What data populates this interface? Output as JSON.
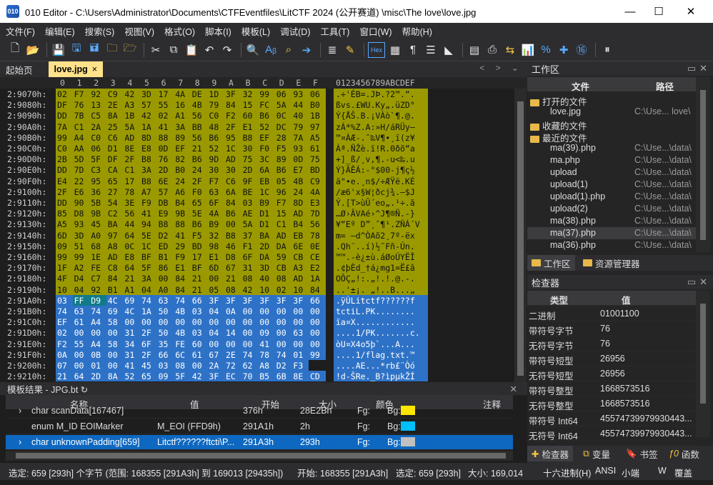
{
  "window": {
    "title": "010 Editor - C:\\Users\\Administrator\\Documents\\CTFEventfiles\\LitCTF 2024 (公开赛道) \\misc\\The love\\love.jpg",
    "icon": "010"
  },
  "menu": [
    "文件(F)",
    "编辑(E)",
    "搜索(S)",
    "视图(V)",
    "格式(O)",
    "脚本(I)",
    "模板(L)",
    "调试(D)",
    "工具(T)",
    "窗口(W)",
    "帮助(H)"
  ],
  "toolbar": {
    "hex_label": "Hex"
  },
  "tabs": [
    {
      "label": "起始页"
    },
    {
      "label": "love.jpg",
      "close": "×"
    }
  ],
  "tab_nav": "< > ⌄",
  "hex": {
    "columns": [
      "0",
      "1",
      "2",
      "3",
      "4",
      "5",
      "6",
      "7",
      "8",
      "9",
      "A",
      "B",
      "C",
      "D",
      "E",
      "F"
    ],
    "ascii_header": "0123456789ABCDEF",
    "rows": [
      {
        "addr": "2:9070h:",
        "bytes": [
          "02",
          "F7",
          "92",
          "C9",
          "42",
          "3D",
          "17",
          "4A",
          "DE",
          "1D",
          "3F",
          "32",
          "99",
          "06",
          "93",
          "06"
        ],
        "ascii": ".÷'ÉB=.JÞ.?2™.“."
      },
      {
        "addr": "2:9080h:",
        "bytes": [
          "DF",
          "76",
          "13",
          "2E",
          "A3",
          "57",
          "55",
          "16",
          "4B",
          "79",
          "84",
          "15",
          "FC",
          "5A",
          "44",
          "B0"
        ],
        "ascii": "ßvs.£WU.Ky„.üZD°"
      },
      {
        "addr": "2:9090h:",
        "bytes": [
          "DD",
          "7B",
          "C5",
          "8A",
          "1B",
          "42",
          "02",
          "A1",
          "56",
          "C0",
          "F2",
          "60",
          "B6",
          "0C",
          "40",
          "1B"
        ],
        "ascii": "Ý{ÅŠ.B.¡VÀò`¶.@."
      },
      {
        "addr": "2:90A0h:",
        "bytes": [
          "7A",
          "C1",
          "2A",
          "25",
          "5A",
          "1A",
          "41",
          "3A",
          "BB",
          "48",
          "2F",
          "E1",
          "52",
          "DC",
          "79",
          "97"
        ],
        "ascii": "zÁ*%Z.A:»H/áRÜy—"
      },
      {
        "addr": "2:90B0h:",
        "bytes": [
          "99",
          "A4",
          "C0",
          "C6",
          "AD",
          "8D",
          "88",
          "89",
          "56",
          "B6",
          "95",
          "B8",
          "EF",
          "28",
          "7A",
          "A5"
        ],
        "ascii": "™¤ÀÆ-.ˆ‰V¶•¸ï(z¥"
      },
      {
        "addr": "2:90C0h:",
        "bytes": [
          "C0",
          "AA",
          "06",
          "D1",
          "8E",
          "E8",
          "0D",
          "EF",
          "21",
          "52",
          "1C",
          "30",
          "F0",
          "F5",
          "93",
          "61"
        ],
        "ascii": "Àª.ÑŽè.ï!R.0ðõ“a"
      },
      {
        "addr": "2:90D0h:",
        "bytes": [
          "2B",
          "5D",
          "5F",
          "DF",
          "2F",
          "B8",
          "76",
          "82",
          "B6",
          "9D",
          "AD",
          "75",
          "3C",
          "89",
          "0D",
          "75"
        ],
        "ascii": "+]_ß/¸v‚¶.-u<‰.u"
      },
      {
        "addr": "2:90E0h:",
        "bytes": [
          "DD",
          "7D",
          "C3",
          "CA",
          "C1",
          "3A",
          "2D",
          "B0",
          "24",
          "30",
          "30",
          "2D",
          "6A",
          "B6",
          "E7",
          "BD"
        ],
        "ascii": "Ý}ÃÊÁ:-°$00-j¶ç½"
      },
      {
        "addr": "2:90F0h:",
        "bytes": [
          "E4",
          "22",
          "95",
          "65",
          "17",
          "B8",
          "6E",
          "24",
          "2F",
          "F7",
          "C6",
          "9F",
          "EB",
          "05",
          "4B",
          "C9"
        ],
        "ascii": "ä\"•e.¸n$/÷ÆŸë.KÉ"
      },
      {
        "addr": "2:9100h:",
        "bytes": [
          "2F",
          "E6",
          "36",
          "27",
          "78",
          "A7",
          "57",
          "A6",
          "F0",
          "63",
          "6A",
          "BE",
          "1C",
          "96",
          "24",
          "4A"
        ],
        "ascii": "/æ6'x§W¦ðcj¾.–$J"
      },
      {
        "addr": "2:9110h:",
        "bytes": [
          "DD",
          "90",
          "5B",
          "54",
          "3E",
          "F9",
          "DB",
          "B4",
          "65",
          "6F",
          "84",
          "03",
          "B9",
          "F7",
          "8D",
          "E3"
        ],
        "ascii": "Ý.[T>ùÛ´eo„.¹÷.ã"
      },
      {
        "addr": "2:9120h:",
        "bytes": [
          "85",
          "D8",
          "9B",
          "C2",
          "56",
          "41",
          "E9",
          "9B",
          "5E",
          "4A",
          "B6",
          "AE",
          "D1",
          "15",
          "AD",
          "7D"
        ],
        "ascii": "…Ø›ÂVAé›^J¶®Ñ.-}"
      },
      {
        "addr": "2:9130h:",
        "bytes": [
          "A5",
          "93",
          "45",
          "BA",
          "44",
          "94",
          "B8",
          "88",
          "B6",
          "B9",
          "00",
          "5A",
          "D1",
          "C1",
          "B4",
          "56"
        ],
        "ascii": "¥“Eº D”¸ˆ¶¹.ZÑÁ´V"
      },
      {
        "addr": "2:9140h:",
        "bytes": [
          "6D",
          "3D",
          "A0",
          "97",
          "64",
          "5E",
          "D2",
          "41",
          "F5",
          "32",
          "B8",
          "37",
          "BA",
          "AD",
          "EB",
          "78"
        ],
        "ascii": "m= —d^ÒAõ2¸7º-ëx"
      },
      {
        "addr": "2:9150h:",
        "bytes": [
          "09",
          "51",
          "68",
          "A8",
          "0C",
          "1C",
          "ED",
          "29",
          "BD",
          "98",
          "46",
          "F1",
          "2D",
          "DA",
          "6E",
          "0E"
        ],
        "ascii": ".Qh¨..í)½˜Fñ-Ún."
      },
      {
        "addr": "2:9160h:",
        "bytes": [
          "99",
          "99",
          "1E",
          "AD",
          "E8",
          "BF",
          "B1",
          "F9",
          "17",
          "E1",
          "D8",
          "6F",
          "DA",
          "59",
          "CB",
          "CE"
        ],
        "ascii": "™™.-è¿±ù.áØoÚYËÎ"
      },
      {
        "addr": "2:9170h:",
        "bytes": [
          "1F",
          "A2",
          "FE",
          "C8",
          "64",
          "5F",
          "86",
          "E1",
          "BF",
          "6D",
          "67",
          "31",
          "3D",
          "CB",
          "A3",
          "E2"
        ],
        "ascii": ".¢þÈd_†á¿mg1=Ë£â"
      },
      {
        "addr": "2:9180h:",
        "bytes": [
          "4F",
          "D4",
          "C7",
          "84",
          "21",
          "3A",
          "00",
          "84",
          "21",
          "00",
          "21",
          "08",
          "40",
          "08",
          "AD",
          "1A"
        ],
        "ascii": "OÔÇ„!:.„!.!.@.-."
      },
      {
        "addr": "2:9190h:",
        "bytes": [
          "10",
          "04",
          "92",
          "B1",
          "A1",
          "04",
          "A0",
          "84",
          "21",
          "05",
          "08",
          "42",
          "10",
          "02",
          "10",
          "84"
        ],
        "ascii": "..'±¡. „!..B...„"
      },
      {
        "addr": "2:91A0h:",
        "bytes": [
          "03",
          "FF",
          "D9",
          "4C",
          "69",
          "74",
          "63",
          "74",
          "66",
          "3F",
          "3F",
          "3F",
          "3F",
          "3F",
          "3F",
          "66"
        ],
        "ascii": ".ÿÙLitctf??????f"
      },
      {
        "addr": "2:91B0h:",
        "bytes": [
          "74",
          "63",
          "74",
          "69",
          "4C",
          "1A",
          "50",
          "4B",
          "03",
          "04",
          "0A",
          "00",
          "00",
          "00",
          "00",
          "00"
        ],
        "ascii": "tctiL.PK........"
      },
      {
        "addr": "2:91C0h:",
        "bytes": [
          "EF",
          "61",
          "A4",
          "58",
          "00",
          "00",
          "00",
          "00",
          "00",
          "00",
          "00",
          "00",
          "00",
          "00",
          "00",
          "00"
        ],
        "ascii": "ïa¤X............"
      },
      {
        "addr": "2:91D0h:",
        "bytes": [
          "02",
          "00",
          "00",
          "00",
          "31",
          "2F",
          "50",
          "4B",
          "03",
          "04",
          "14",
          "00",
          "09",
          "00",
          "63",
          "00"
        ],
        "ascii": "....1/PK.......c."
      },
      {
        "addr": "2:91E0h:",
        "bytes": [
          "F2",
          "55",
          "A4",
          "58",
          "34",
          "6F",
          "35",
          "FE",
          "60",
          "00",
          "00",
          "00",
          "41",
          "00",
          "00",
          "00"
        ],
        "ascii": "òU¤X4o5þ`...A..."
      },
      {
        "addr": "2:91F0h:",
        "bytes": [
          "0A",
          "00",
          "0B",
          "00",
          "31",
          "2F",
          "66",
          "6C",
          "61",
          "67",
          "2E",
          "74",
          "78",
          "74",
          "01",
          "99"
        ],
        "ascii": "....1/flag.txt.™"
      },
      {
        "addr": "2:9200h:",
        "bytes": [
          "07",
          "00",
          "01",
          "00",
          "41",
          "45",
          "03",
          "08",
          "00",
          "2A",
          "72",
          "62",
          "A8",
          "D2",
          "F3"
        ],
        "ascii": "....AE...*rb£¨Òó"
      },
      {
        "addr": "2:9210h:",
        "bytes": [
          "21",
          "64",
          "2D",
          "8A",
          "52",
          "65",
          "09",
          "5F",
          "42",
          "3F",
          "EC",
          "70",
          "B5",
          "6B",
          "8E",
          "CD"
        ],
        "ascii": "!d-ŠRe._B?ìpµkŽÍ"
      }
    ],
    "colors": {
      "olive": "#9a9a00",
      "blue": "#2e72c7",
      "teal": "#117a87",
      "cursor": "#4aa0c8"
    }
  },
  "template": {
    "title": "模板结果 - JPG.bt ↻",
    "columns": [
      "名称",
      "值",
      "开始",
      "大小",
      "颜色",
      "注释"
    ],
    "rows": [
      {
        "name": "char scanData[167467]",
        "value": "",
        "start": "376h",
        "size": "28E2Bh",
        "fg": "Fg:",
        "bg": "Bg:",
        "bgcolor": "#ffe600",
        "selected": false,
        "expander": "›"
      },
      {
        "name": "enum M_ID EOIMarker",
        "value": "M_EOI (FFD9h)",
        "start": "291A1h",
        "size": "2h",
        "fg": "Fg:",
        "bg": "Bg:",
        "bgcolor": "#00bfff",
        "selected": false,
        "expander": ""
      },
      {
        "name": "char unknownPadding[659]",
        "value": "Litctf??????ftcti\\P...",
        "start": "291A3h",
        "size": "293h",
        "fg": "Fg:",
        "bg": "Bg:",
        "bgcolor": "#c0c0c0",
        "selected": true,
        "expander": "›"
      }
    ]
  },
  "status": {
    "selection": "选定: 659 [293h] 个字节 (范围: 168355 [291A3h] 到 169013 [29435h])",
    "start": "开始: 168355 [291A3h]",
    "selected": "选定: 659 [293h]",
    "size": "大小: 169,014",
    "mode": "十六进制(H)",
    "encoding": "ANSI",
    "endian": "小端",
    "write": "W",
    "overwrite": "覆盖"
  },
  "workspace": {
    "title": "工作区",
    "columns": [
      "文件",
      "路径"
    ],
    "sections": {
      "open": "打开的文件",
      "favorites": "收藏的文件",
      "recent": "最近的文件"
    },
    "open_files": [
      {
        "name": "love.jpg",
        "path": "C:\\Use... love\\"
      }
    ],
    "recent_files": [
      {
        "name": "ma(39).php",
        "path": "C:\\Use...\\data\\"
      },
      {
        "name": "ma.php",
        "path": "C:\\Use...\\data\\"
      },
      {
        "name": "upload",
        "path": "C:\\Use...\\data\\"
      },
      {
        "name": "upload(1)",
        "path": "C:\\Use...\\data\\"
      },
      {
        "name": "upload(1).php",
        "path": "C:\\Use...\\data\\"
      },
      {
        "name": "upload(2)",
        "path": "C:\\Use...\\data\\"
      },
      {
        "name": "ma(38).php",
        "path": "C:\\Use...\\data\\"
      },
      {
        "name": "ma(37).php",
        "path": "C:\\Use...\\data\\"
      },
      {
        "name": "ma(36).php",
        "path": "C:\\Use...\\data\\"
      }
    ],
    "tabs": [
      "工作区",
      "资源管理器"
    ]
  },
  "inspector": {
    "title": "检查器",
    "columns": [
      "类型",
      "值"
    ],
    "rows": [
      {
        "type": "二进制",
        "value": "01001100"
      },
      {
        "type": "带符号字节",
        "value": "76"
      },
      {
        "type": "无符号字节",
        "value": "76"
      },
      {
        "type": "带符号短型",
        "value": "26956"
      },
      {
        "type": "无符号短型",
        "value": "26956"
      },
      {
        "type": "带符号整型",
        "value": "1668573516"
      },
      {
        "type": "无符号整型",
        "value": "1668573516"
      },
      {
        "type": "带符号 Int64",
        "value": "45574739979930443..."
      },
      {
        "type": "无符号 Int64",
        "value": "45574739979930443..."
      }
    ],
    "tabs": [
      "检查器",
      "变量",
      "书签",
      "函数"
    ]
  }
}
